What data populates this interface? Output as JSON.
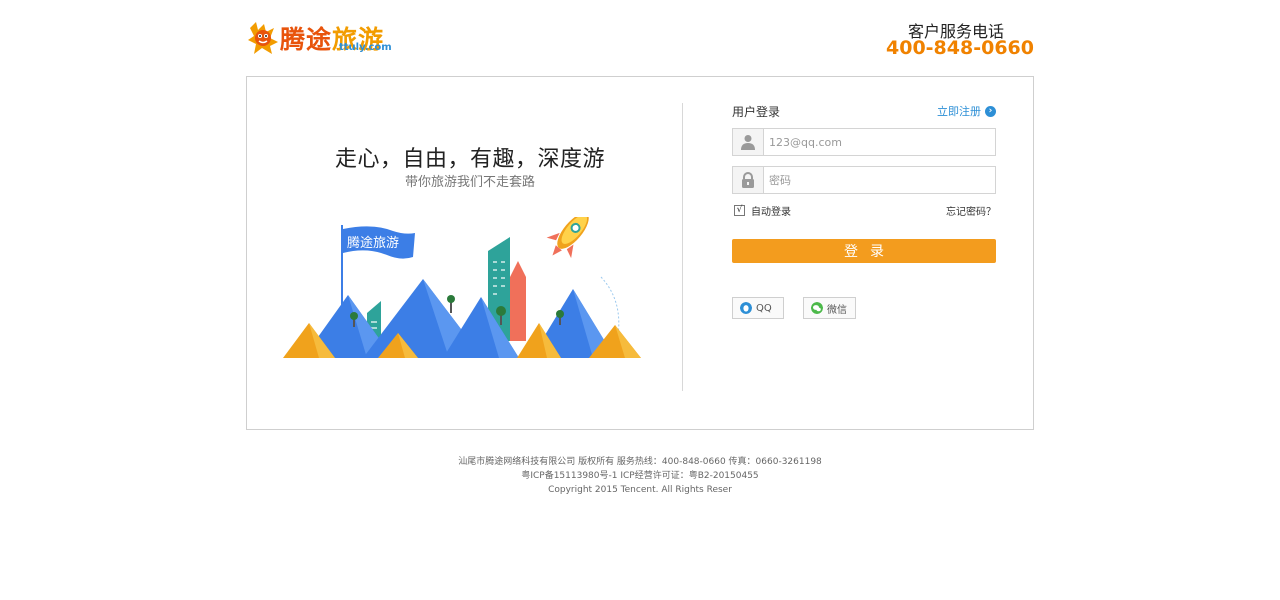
{
  "header": {
    "logo_main": "腾途",
    "logo_accent": "旅游",
    "logo_sub": "ttuly.com",
    "service_label": "客户服务电话",
    "service_phone": "400-848-0660"
  },
  "hero": {
    "slogan": "走心，自由，有趣，深度游",
    "subtitle": "带你旅游我们不走套路",
    "flag_text": "腾途旅游"
  },
  "login": {
    "title": "用户登录",
    "register_label": "立即注册",
    "username_placeholder": "123@qq.com",
    "password_placeholder": "密码",
    "remember_check": "√",
    "remember_label": "自动登录",
    "forgot_label": "忘记密码？",
    "submit_label": "登录",
    "qq_label": "QQ",
    "wechat_label": "微信"
  },
  "footer": {
    "line1": "汕尾市腾途网络科技有限公司 版权所有 服务热线：400-848-0660 传真：0660-3261198",
    "line2": "粤ICP备15113980号-1 ICP经营许可证：粤B2-20150455",
    "line3": "Copyright 2015 Tencent. All Rights Reser"
  },
  "colors": {
    "brand_orange": "#f08200",
    "button_orange": "#f39c1e",
    "link_blue": "#2d8fd6"
  }
}
